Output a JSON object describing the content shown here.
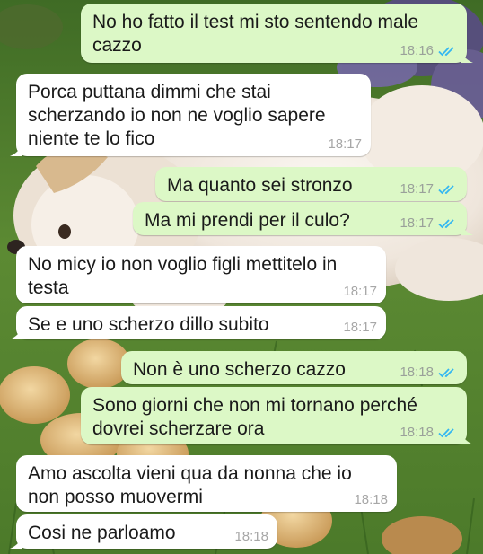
{
  "colors": {
    "incoming_bubble": "#ffffff",
    "outgoing_bubble": "#dcf8c6",
    "read_ticks": "#34b7f1",
    "time_text": "#9aa19a"
  },
  "messages": [
    {
      "direction": "out",
      "text": "No ho fatto il test mi sto sentendo male\ncazzo",
      "time": "18:16",
      "status": "read"
    },
    {
      "direction": "in",
      "text": "Porca puttana dimmi che stai\nscherzando io non ne voglio sapere\nniente te lo fico",
      "time": "18:17"
    },
    {
      "direction": "out",
      "text": "Ma quanto sei stronzo",
      "time": "18:17",
      "status": "read"
    },
    {
      "direction": "out",
      "text": "Ma mi prendi per il culo?",
      "time": "18:17",
      "status": "read"
    },
    {
      "direction": "in",
      "text": "No micy io non voglio figli mettitelo in\ntesta",
      "time": "18:17"
    },
    {
      "direction": "in",
      "text": "Se e uno scherzo dillo subito",
      "time": "18:17"
    },
    {
      "direction": "out",
      "text": "Non è uno scherzo cazzo",
      "time": "18:18",
      "status": "read"
    },
    {
      "direction": "out",
      "text": "Sono giorni che non mi tornano perché\ndovrei scherzare ora",
      "time": "18:18",
      "status": "read"
    },
    {
      "direction": "in",
      "text": "Amo ascolta vieni qua da nonna che io\nnon posso muovermi",
      "time": "18:18"
    },
    {
      "direction": "in",
      "text": "Cosi ne parloamo",
      "time": "18:18"
    }
  ]
}
